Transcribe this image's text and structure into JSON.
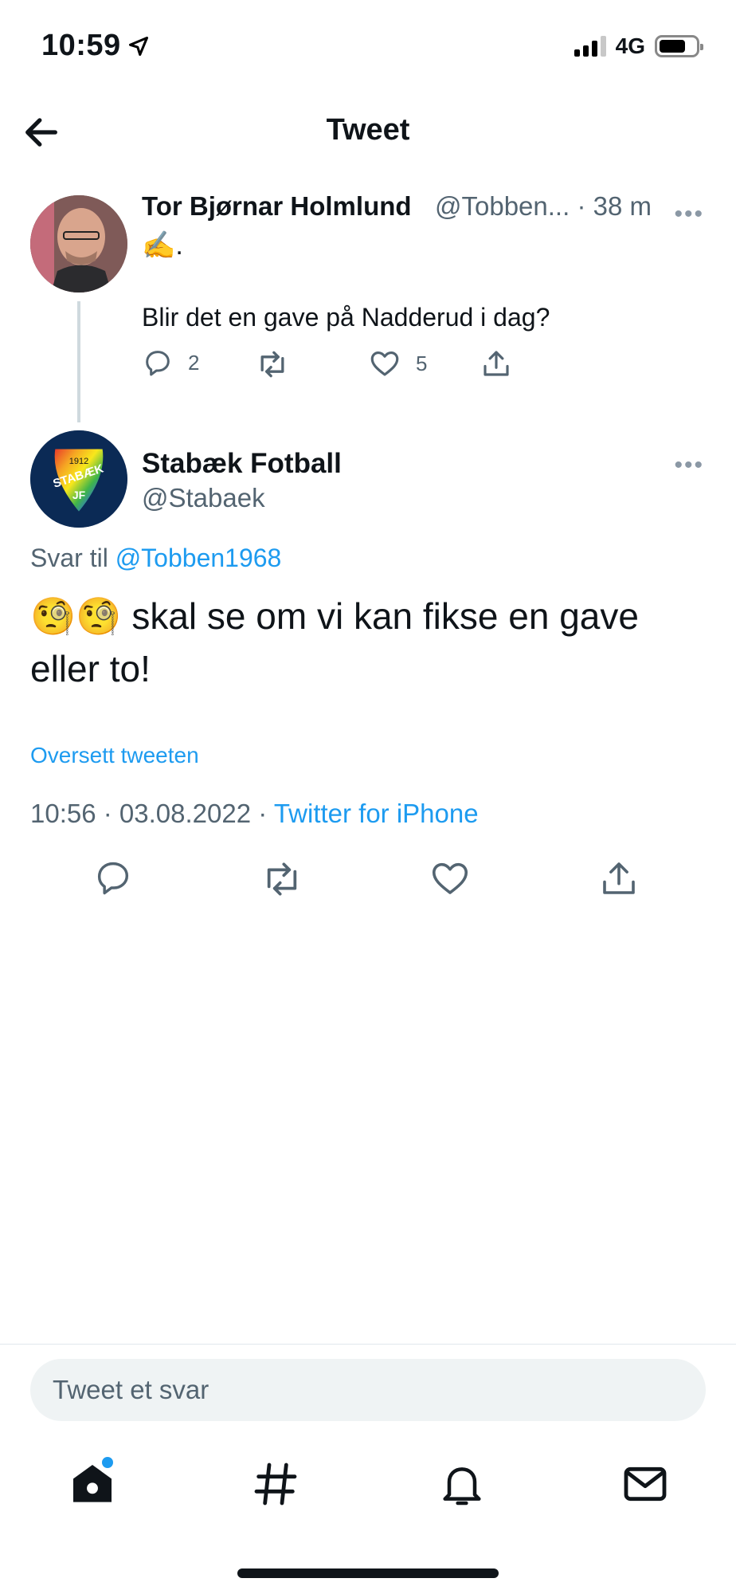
{
  "status": {
    "time": "10:59",
    "network": "4G"
  },
  "header": {
    "title": "Tweet"
  },
  "parent_tweet": {
    "name": "Tor Bjørnar Holmlund",
    "handle_time": "@Tobben... · 38 m",
    "emoji_line": "✍️.",
    "text": "Blir det en gave på Nadderud i dag?",
    "reply_count": "2",
    "like_count": "5"
  },
  "main_tweet": {
    "name": "Stabæk Fotball",
    "handle": "@Stabaek",
    "reply_prefix": "Svar til ",
    "reply_handle": "@Tobben1968",
    "text": "🧐🧐 skal se om vi kan fikse en gave eller to!",
    "translate": "Oversett tweeten",
    "timestamp": "10:56 · 03.08.2022 · ",
    "source": "Twitter for iPhone",
    "avatar_text_top": "1912",
    "avatar_text_mid": "STABÆK",
    "avatar_text_bottom": "JF"
  },
  "reply_bar": {
    "placeholder": "Tweet et svar"
  },
  "colors": {
    "accent": "#1d9bf0",
    "muted": "#536471",
    "text": "#0f1419"
  }
}
